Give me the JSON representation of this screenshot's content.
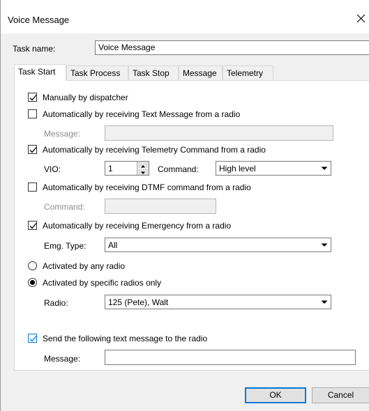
{
  "window": {
    "title": "Voice Message"
  },
  "task_name": {
    "label": "Task name:",
    "value": "Voice Message"
  },
  "tabs": [
    {
      "label": "Task Start",
      "active": true
    },
    {
      "label": "Task Process",
      "active": false
    },
    {
      "label": "Task Stop",
      "active": false
    },
    {
      "label": "Message",
      "active": false
    },
    {
      "label": "Telemetry",
      "active": false
    }
  ],
  "task_start": {
    "manual": {
      "label": "Manually by dispatcher",
      "checked": true
    },
    "text_message": {
      "label": "Automatically by receiving Text Message from a radio",
      "checked": false,
      "message_label": "Message:",
      "message_value": ""
    },
    "telemetry": {
      "label": "Automatically by receiving Telemetry Command from a radio",
      "checked": true,
      "vio_label": "VIO:",
      "vio_value": "1",
      "command_label": "Command:",
      "command_value": "High level"
    },
    "dtmf": {
      "label": "Automatically by receiving DTMF command from a radio",
      "checked": false,
      "command_label": "Command:",
      "command_value": ""
    },
    "emergency": {
      "label": "Automatically by receiving Emergency from a radio",
      "checked": true,
      "type_label": "Emg. Type:",
      "type_value": "All"
    },
    "any_radio": {
      "label": "Activated by any radio",
      "selected": false
    },
    "specific_radios": {
      "label": "Activated by specific radios only",
      "selected": true,
      "radio_label": "Radio:",
      "radio_value": "125 (Pete), Walt"
    },
    "send_text": {
      "label": "Send the following text message to the radio",
      "checked": true,
      "message_label": "Message:",
      "message_value": ""
    }
  },
  "buttons": {
    "ok": "OK",
    "cancel": "Cancel"
  },
  "colors": {
    "accent": "#0078d7",
    "dialog_bg": "#f0f0f0",
    "panel_bg": "#ffffff"
  }
}
